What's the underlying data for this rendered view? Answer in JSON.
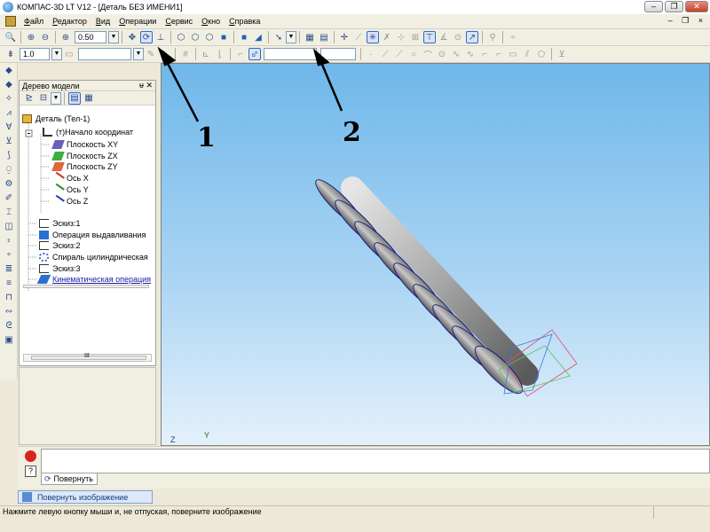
{
  "window": {
    "title": "КОМПАС-3D LT V12 - [Деталь БЕЗ ИМЕНИ1]",
    "buttons": [
      "–",
      "❐",
      "✕"
    ]
  },
  "menu": {
    "items": [
      "Файл",
      "Редактор",
      "Вид",
      "Операции",
      "Сервис",
      "Окно",
      "Справка"
    ],
    "mdi_controls": "– ❐ ×"
  },
  "toolbar": {
    "zoom_value": "0.50",
    "step_value": "1.0"
  },
  "model_tree": {
    "header_title": "Дерево модели",
    "header_controls": "ᵾ ✕",
    "nodes": [
      "Деталь (Тел-1)",
      "(т)Начало координат",
      "Плоскость XY",
      "Плоскость ZX",
      "Плоскость ZY",
      "Ось X",
      "Ось Y",
      "Ось Z",
      "Эскиз:1",
      "Операция выдавливания",
      "Эскиз:2",
      "Спираль цилиндрическая",
      "Эскиз:3",
      "Кинематическая операция"
    ],
    "scroll_label": "III"
  },
  "viewport": {
    "axis_z": "Z",
    "axis_y": "Y"
  },
  "bottom_panel": {
    "rotate_tab_label": "Повернуть",
    "help_label": "?"
  },
  "taskbar": {
    "tab_label": "Повернуть изображение"
  },
  "status": {
    "hint": "Нажмите левую кнопку мыши и, не отпуская, поверните изображение"
  },
  "annotations": {
    "label_1": "1",
    "label_2": "2"
  },
  "colors": {
    "accent": "#316ac5",
    "viewport_top": "#6fb7ea",
    "part_fill": "#b8b8b8",
    "part_edge": "#2a2a8a"
  }
}
